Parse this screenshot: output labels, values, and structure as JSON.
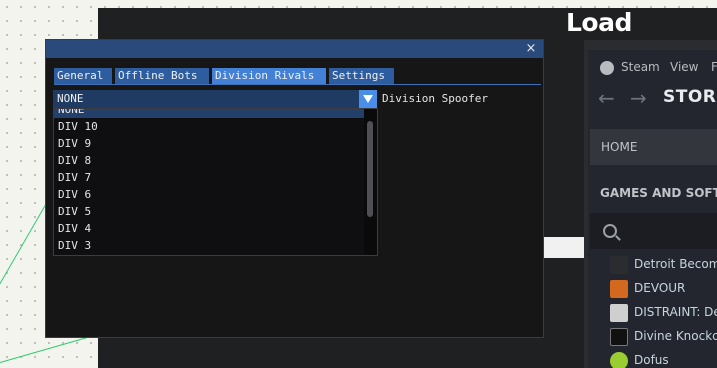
{
  "background": {
    "accent_line_color": "#2ecc71"
  },
  "app_title": "Load",
  "steam": {
    "menu": [
      "Steam",
      "View",
      "F"
    ],
    "store_label": "STORE",
    "home_label": "HOME",
    "games_header": "GAMES AND SOFTW",
    "games": [
      {
        "name": "Detroit Becom",
        "icon_color": "#2a2c30"
      },
      {
        "name": "DEVOUR",
        "icon_color": "#d2691e"
      },
      {
        "name": "DISTRAINT: De",
        "icon_color": "#cfcfcf"
      },
      {
        "name": "Divine Knockc",
        "icon_color": "#111111"
      },
      {
        "name": "Dofus",
        "icon_color": "#9acd32"
      }
    ]
  },
  "imgui": {
    "close_glyph": "×",
    "tabs": [
      {
        "label": "General",
        "active": false
      },
      {
        "label": "Offline Bots",
        "active": false
      },
      {
        "label": "Division Rivals",
        "active": true
      },
      {
        "label": "Settings",
        "active": false
      }
    ],
    "combo": {
      "value": "NONE",
      "label": "Division Spoofer",
      "options": [
        "NONE",
        "DIV 10",
        "DIV 9",
        "DIV 8",
        "DIV 7",
        "DIV 6",
        "DIV 5",
        "DIV 4",
        "DIV 3"
      ]
    }
  }
}
